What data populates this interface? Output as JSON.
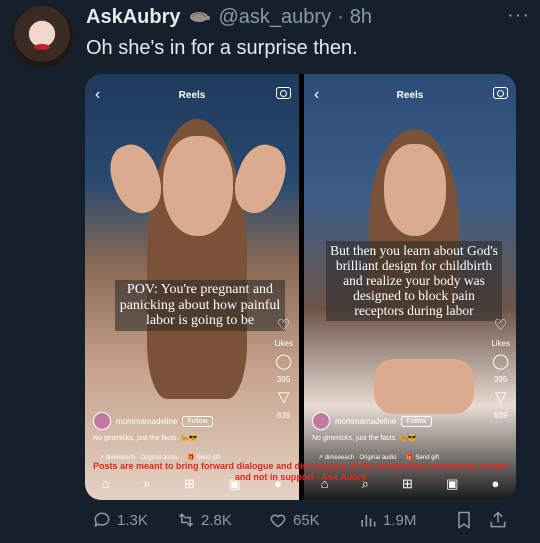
{
  "tweet": {
    "name": "AskAubry",
    "handle": "@ask_aubry",
    "separator": "·",
    "time": "8h",
    "more_label": "···",
    "text": "Oh she's in for a surprise then."
  },
  "media": {
    "left": {
      "title": "Reels",
      "caption": "POV: You're pregnant and panicking about how painful labor is going to be",
      "likes_label": "Likes",
      "comments": "395",
      "shares": "639",
      "username": "mommamadeline",
      "follow_label": "Follow",
      "description": "No gimmicks, just the facts. 🐆😎",
      "audio": "↗ dimeeeach · Original audio",
      "gift": "🎁 Send gift"
    },
    "right": {
      "title": "Reels",
      "caption": "But then you learn about God's brilliant design for childbirth and realize your body was designed to block pain receptors during labor",
      "likes_label": "Likes",
      "comments": "395",
      "shares": "639",
      "username": "mommamadeline",
      "follow_label": "Follow",
      "description": "No gimmicks, just the facts. 🐆😎",
      "audio": "↗ dimeeeach · Original audio",
      "gift": "🎁 Send gift"
    },
    "watermark": "Posts are meant to bring forward dialogue and discussions of the problematic sentiments shown and not in support - Ask Aubry"
  },
  "actions": {
    "replies": "1.3K",
    "reposts": "2.8K",
    "likes": "65K",
    "views": "1.9M"
  },
  "colors": {
    "background": "#15202b",
    "muted": "#8b98a5",
    "watermark": "#e8261c"
  }
}
